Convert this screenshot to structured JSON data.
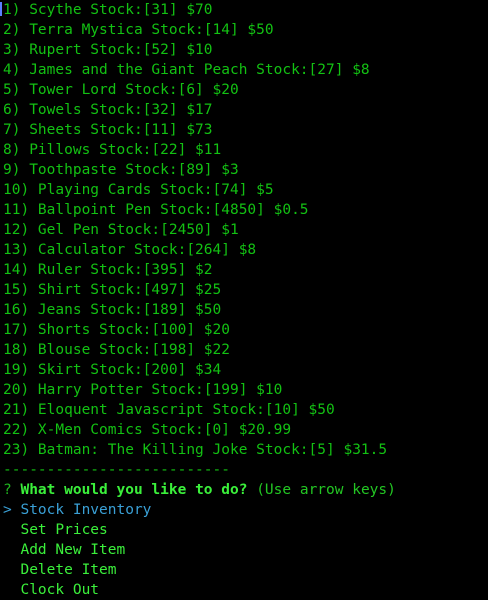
{
  "inventory": [
    "1) Scythe Stock:[31] $70",
    "2) Terra Mystica Stock:[14] $50",
    "3) Rupert Stock:[52] $10",
    "4) James and the Giant Peach Stock:[27] $8",
    "5) Tower Lord Stock:[6] $20",
    "6) Towels Stock:[32] $17",
    "7) Sheets Stock:[11] $73",
    "8) Pillows Stock:[22] $11",
    "9) Toothpaste Stock:[89] $3",
    "10) Playing Cards Stock:[74] $5",
    "11) Ballpoint Pen Stock:[4850] $0.5",
    "12) Gel Pen Stock:[2450] $1",
    "13) Calculator Stock:[264] $8",
    "14) Ruler Stock:[395] $2",
    "15) Shirt Stock:[497] $25",
    "16) Jeans Stock:[189] $50",
    "17) Shorts Stock:[100] $20",
    "18) Blouse Stock:[198] $22",
    "19) Skirt Stock:[200] $34",
    "20) Harry Potter Stock:[199] $10",
    "21) Eloquent Javascript Stock:[10] $50",
    "22) X-Men Comics Stock:[0] $20.99",
    "23) Batman: The Killing Joke Stock:[5] $31.5"
  ],
  "separator": "--------------------------",
  "prompt": {
    "marker": "?",
    "question": "What would you like to do?",
    "hint": "(Use arrow keys)"
  },
  "menu": {
    "pointer": ">",
    "choices": [
      "Stock Inventory",
      "Set Prices",
      "Add New Item",
      "Delete Item",
      "Clock Out"
    ]
  },
  "colors": {
    "text": "#13c113",
    "question": "#3bf03b",
    "selected": "#3aa0d6",
    "background": "#000000"
  }
}
